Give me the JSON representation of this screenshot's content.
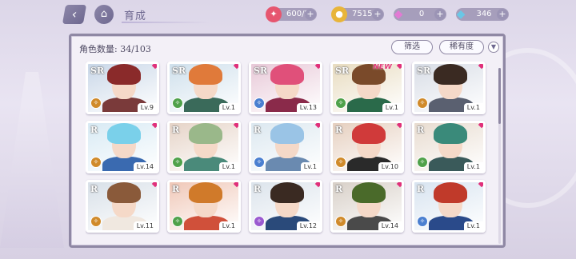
{
  "header": {
    "title": "育成",
    "back_icon": "back-arrow-icon",
    "home_icon": "home-icon"
  },
  "resources": [
    {
      "name": "stamina",
      "icon": "candy-icon",
      "value": "600/50",
      "color": "#e6566f"
    },
    {
      "name": "gold",
      "icon": "coin-icon",
      "value": "751500",
      "color": "#e8b53a"
    },
    {
      "name": "gem-pink",
      "icon": "diamond-pink-icon",
      "value": "0",
      "color": "#e27ad4"
    },
    {
      "name": "gem-blue",
      "icon": "diamond-blue-icon",
      "value": "346",
      "color": "#6ac7e6"
    }
  ],
  "panel": {
    "count_label": "角色数量: 34/103",
    "filter_label": "筛选",
    "rarity_label": "稀有度",
    "sort_icon": "sort-arrow-icon"
  },
  "cards": [
    {
      "rarity": "SR",
      "level": "Lv.9",
      "element": "#d08a2a",
      "hair": "#8a2a2a",
      "bg": "#c9d7e8",
      "body": "#7a3a3a",
      "is_new": false
    },
    {
      "rarity": "SR",
      "level": "Lv.1",
      "element": "#4fa14a",
      "hair": "#e07a3a",
      "bg": "#cfe0ec",
      "body": "#3a6a5a",
      "is_new": false
    },
    {
      "rarity": "SR",
      "level": "Lv.13",
      "element": "#4a7fd0",
      "hair": "#e0507a",
      "bg": "#e8c9d8",
      "body": "#8a2a4a",
      "is_new": false
    },
    {
      "rarity": "SR",
      "level": "Lv.1",
      "element": "#4fa14a",
      "hair": "#7a4a2a",
      "bg": "#e8dcc0",
      "body": "#2a6a4a",
      "is_new": true,
      "new_label": "NEW"
    },
    {
      "rarity": "SR",
      "level": "Lv.1",
      "element": "#d08a2a",
      "hair": "#3a2a22",
      "bg": "#d8dde6",
      "body": "#5a6070",
      "is_new": false
    },
    {
      "rarity": "R",
      "level": "Lv.14",
      "element": "#d08a2a",
      "hair": "#7ad0ea",
      "bg": "#d8eaf4",
      "body": "#3a6ab0",
      "is_new": false
    },
    {
      "rarity": "R",
      "level": "Lv.1",
      "element": "#4fa14a",
      "hair": "#9ab88a",
      "bg": "#e6d4c8",
      "body": "#4a8a7a",
      "is_new": false
    },
    {
      "rarity": "R",
      "level": "Lv.1",
      "element": "#4a7fd0",
      "hair": "#9ac4e6",
      "bg": "#dce8f0",
      "body": "#6a8ab0",
      "is_new": false
    },
    {
      "rarity": "R",
      "level": "Lv.10",
      "element": "#d08a2a",
      "hair": "#d03a3a",
      "bg": "#e6d0c0",
      "body": "#2a2a2a",
      "is_new": false
    },
    {
      "rarity": "R",
      "level": "Lv.1",
      "element": "#4fa14a",
      "hair": "#3a8a7a",
      "bg": "#e8dcd0",
      "body": "#3a5a5a",
      "is_new": false
    },
    {
      "rarity": "R",
      "level": "Lv.11",
      "element": "#d08a2a",
      "hair": "#8a5a3a",
      "bg": "#d8e0e8",
      "body": "#f0e8e0",
      "is_new": false
    },
    {
      "rarity": "R",
      "level": "Lv.1",
      "element": "#4fa14a",
      "hair": "#d07a2a",
      "bg": "#f0c8b8",
      "body": "#d0503a",
      "is_new": false
    },
    {
      "rarity": "R",
      "level": "Lv.12",
      "element": "#9a5ad0",
      "hair": "#3a2a22",
      "bg": "#dce4ec",
      "body": "#2a4a7a",
      "is_new": false
    },
    {
      "rarity": "R",
      "level": "Lv.14",
      "element": "#d08a2a",
      "hair": "#4a6a2a",
      "bg": "#d8d0c8",
      "body": "#4a4a4a",
      "is_new": false
    },
    {
      "rarity": "R",
      "level": "Lv.1",
      "element": "#4a7fd0",
      "hair": "#c03a2a",
      "bg": "#d8e4f0",
      "body": "#2a4a8a",
      "is_new": false
    }
  ]
}
